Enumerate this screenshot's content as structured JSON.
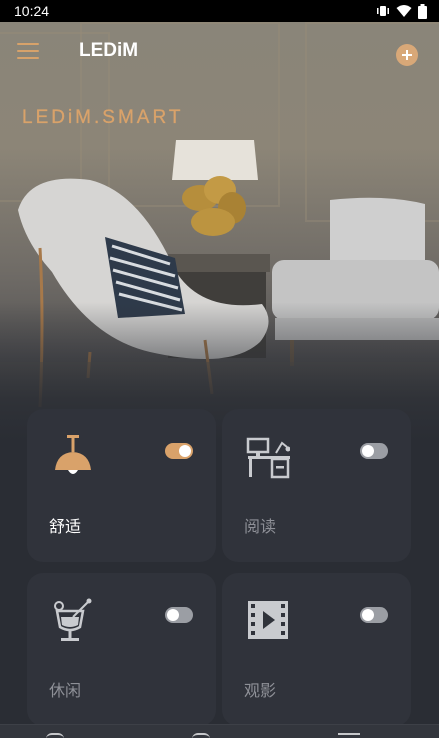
{
  "status_bar": {
    "time": "10:24",
    "icons": [
      "vibrate-icon",
      "wifi-icon",
      "battery-icon"
    ]
  },
  "app_bar": {
    "title": "LEDiM",
    "menu_icon": "hamburger-menu-icon",
    "add_icon": "plus-circle-icon"
  },
  "hero": {
    "brand_text": "LEDiM.SMART"
  },
  "colors": {
    "accent": "#d9a26a",
    "card_bg": "#30333b",
    "page_bg": "#2a2d34",
    "toggle_off": "#9b9ea4"
  },
  "scenes": [
    {
      "label": "舒适",
      "icon": "pendant-lamp-icon",
      "enabled": true
    },
    {
      "label": "阅读",
      "icon": "reading-desk-icon",
      "enabled": false
    },
    {
      "label": "休闲",
      "icon": "cocktail-glass-icon",
      "enabled": false
    },
    {
      "label": "观影",
      "icon": "film-play-icon",
      "enabled": false
    }
  ],
  "bottom_nav": {
    "items": [
      "home-icon",
      "discover-icon",
      "device-icon"
    ]
  }
}
